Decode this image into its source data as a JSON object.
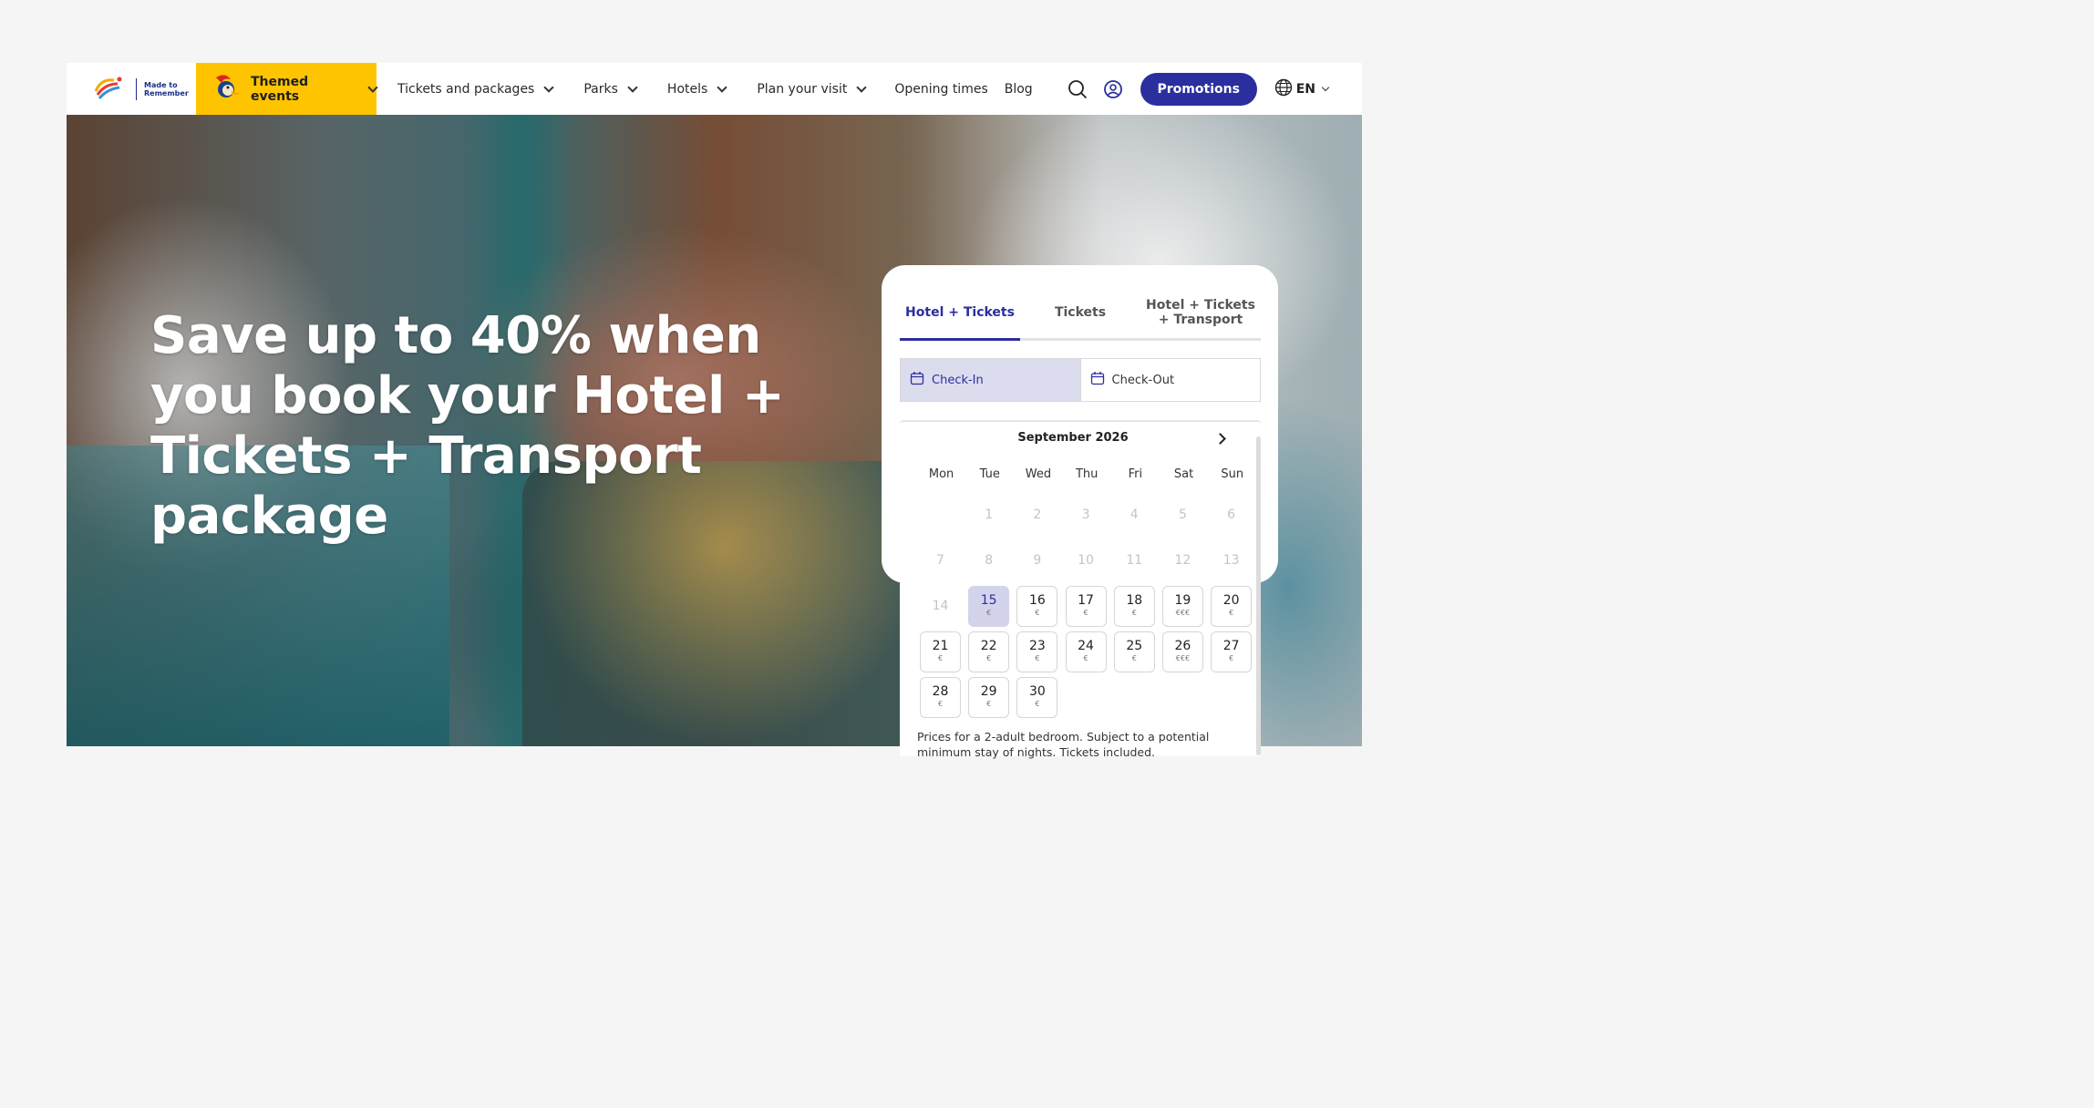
{
  "logo": {
    "brand": "PortAventura WORLD",
    "tagline_line1": "Made to",
    "tagline_line2": "Remember"
  },
  "nav": {
    "themed_events": "Themed events",
    "items": [
      {
        "label": "Tickets and packages",
        "dropdown": true
      },
      {
        "label": "Parks",
        "dropdown": true
      },
      {
        "label": "Hotels",
        "dropdown": true
      },
      {
        "label": "Plan your visit",
        "dropdown": true
      },
      {
        "label": "Opening times",
        "dropdown": false
      },
      {
        "label": "Blog",
        "dropdown": false
      }
    ],
    "promotions": "Promotions",
    "language": "EN"
  },
  "hero": {
    "title": "Save up to 40% when you book your Hotel + Tickets + Transport package"
  },
  "booking": {
    "tabs": [
      {
        "label": "Hotel + Tickets",
        "active": true
      },
      {
        "label": "Tickets",
        "active": false
      },
      {
        "label": "Hotel + Tickets + Transport",
        "active": false
      }
    ],
    "check_in": "Check-In",
    "check_out": "Check-Out"
  },
  "calendar": {
    "month": "September 2026",
    "weekdays": [
      "Mon",
      "Tue",
      "Wed",
      "Thu",
      "Fri",
      "Sat",
      "Sun"
    ],
    "days": [
      {
        "day": "",
        "state": "empty",
        "price": ""
      },
      {
        "day": "1",
        "state": "disabled",
        "price": ""
      },
      {
        "day": "2",
        "state": "disabled",
        "price": ""
      },
      {
        "day": "3",
        "state": "disabled",
        "price": ""
      },
      {
        "day": "4",
        "state": "disabled",
        "price": ""
      },
      {
        "day": "5",
        "state": "disabled",
        "price": ""
      },
      {
        "day": "6",
        "state": "disabled",
        "price": ""
      },
      {
        "day": "7",
        "state": "disabled",
        "price": ""
      },
      {
        "day": "8",
        "state": "disabled",
        "price": ""
      },
      {
        "day": "9",
        "state": "disabled",
        "price": ""
      },
      {
        "day": "10",
        "state": "disabled",
        "price": ""
      },
      {
        "day": "11",
        "state": "disabled",
        "price": ""
      },
      {
        "day": "12",
        "state": "disabled",
        "price": ""
      },
      {
        "day": "13",
        "state": "disabled",
        "price": ""
      },
      {
        "day": "14",
        "state": "disabled",
        "price": ""
      },
      {
        "day": "15",
        "state": "selected",
        "price": "€"
      },
      {
        "day": "16",
        "state": "avail",
        "price": "€"
      },
      {
        "day": "17",
        "state": "avail",
        "price": "€"
      },
      {
        "day": "18",
        "state": "avail",
        "price": "€"
      },
      {
        "day": "19",
        "state": "avail",
        "price": "€€€"
      },
      {
        "day": "20",
        "state": "avail",
        "price": "€"
      },
      {
        "day": "21",
        "state": "avail",
        "price": "€"
      },
      {
        "day": "22",
        "state": "avail",
        "price": "€"
      },
      {
        "day": "23",
        "state": "avail",
        "price": "€"
      },
      {
        "day": "24",
        "state": "avail",
        "price": "€"
      },
      {
        "day": "25",
        "state": "avail",
        "price": "€"
      },
      {
        "day": "26",
        "state": "avail",
        "price": "€€€"
      },
      {
        "day": "27",
        "state": "avail",
        "price": "€"
      },
      {
        "day": "28",
        "state": "avail",
        "price": "€"
      },
      {
        "day": "29",
        "state": "avail",
        "price": "€"
      },
      {
        "day": "30",
        "state": "avail",
        "price": "€"
      }
    ],
    "note": "Prices for a 2-adult bedroom. Subject to a potential minimum stay of nights. Tickets included."
  },
  "colors": {
    "brand": "#2b2e9e",
    "themed": "#ffc400",
    "selected_day": "#d3d3ec"
  }
}
